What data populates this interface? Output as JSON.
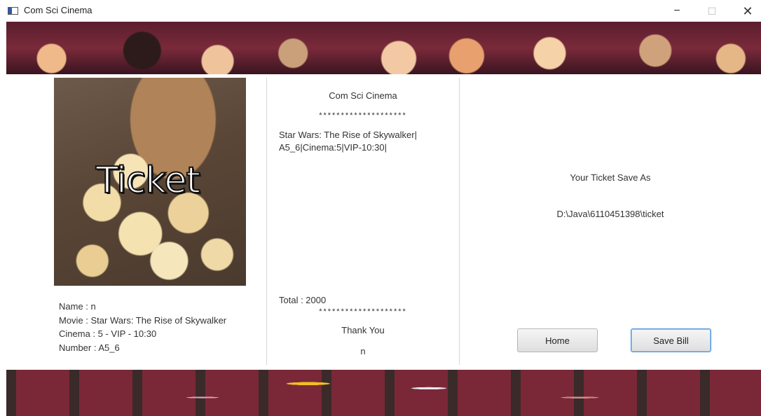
{
  "window": {
    "title": "Com Sci Cinema",
    "minimize": "−",
    "maximize": "☐",
    "close": "✕"
  },
  "poster": {
    "caption": "Ticket"
  },
  "details": {
    "name": "Name  :  n",
    "movie": "Movie  :   Star Wars: The Rise of Skywalker",
    "cinema": "Cinema  :  5 - VIP - 10:30",
    "number": "Number  :   A5_6"
  },
  "receipt": {
    "title": "Com Sci Cinema",
    "stars": "********************",
    "line1": "Star Wars: The Rise of Skywalker|",
    "line2": "A5_6|Cinema:5|VIP-10:30|",
    "total": "Total : 2000",
    "thanks": "Thank You",
    "name": "n"
  },
  "save": {
    "label": "Your Ticket Save As",
    "path": "D:\\Java\\6110451398\\ticket"
  },
  "buttons": {
    "home": "Home",
    "save_bill": "Save Bill"
  },
  "colors": {
    "accent_border": "#4a90d9"
  }
}
